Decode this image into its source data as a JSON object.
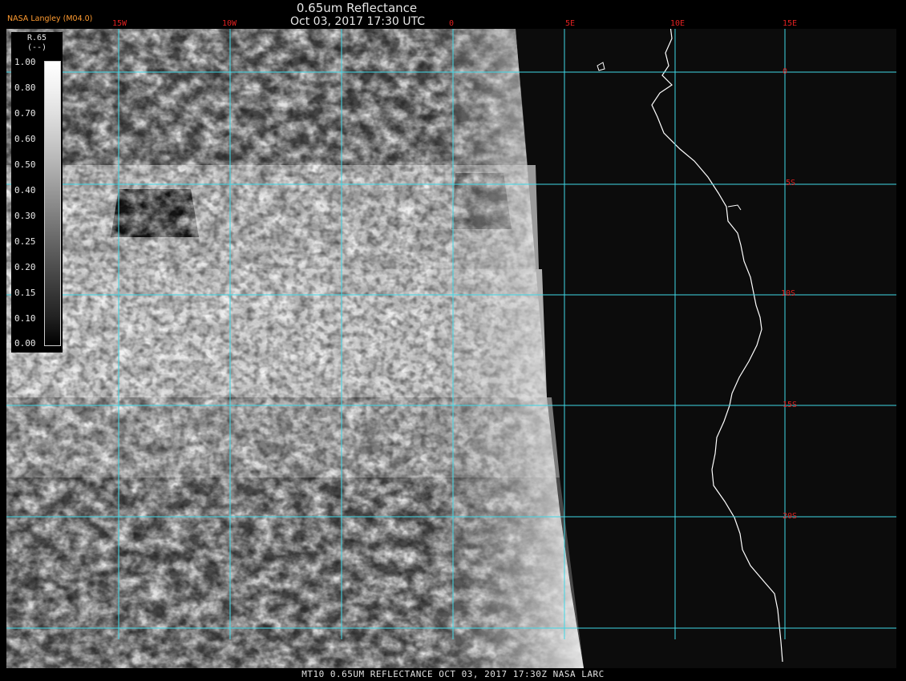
{
  "header": {
    "title": "0.65um Reflectance",
    "datetime": "Oct 03, 2017 17:30 UTC",
    "credit": "NASA Langley (M04.0)"
  },
  "grid": {
    "longitude_labels": [
      "15W",
      "10W",
      "0",
      "5E",
      "10E",
      "15E"
    ],
    "latitude_labels": [
      "0",
      "5S",
      "10S",
      "15S",
      "20S"
    ],
    "line_color": "#3fd8e6",
    "label_color": "#e02020"
  },
  "legend": {
    "title": "R.65",
    "units": "(--)",
    "ticks": [
      "1.00",
      "0.80",
      "0.70",
      "0.60",
      "0.50",
      "0.40",
      "0.30",
      "0.25",
      "0.20",
      "0.15",
      "0.10",
      "0.00"
    ]
  },
  "coastline_color": "#ffffff",
  "footer": {
    "caption": "MT10  0.65UM REFLECTANCE   OCT 03, 2017 17:30Z   NASA LARC"
  }
}
